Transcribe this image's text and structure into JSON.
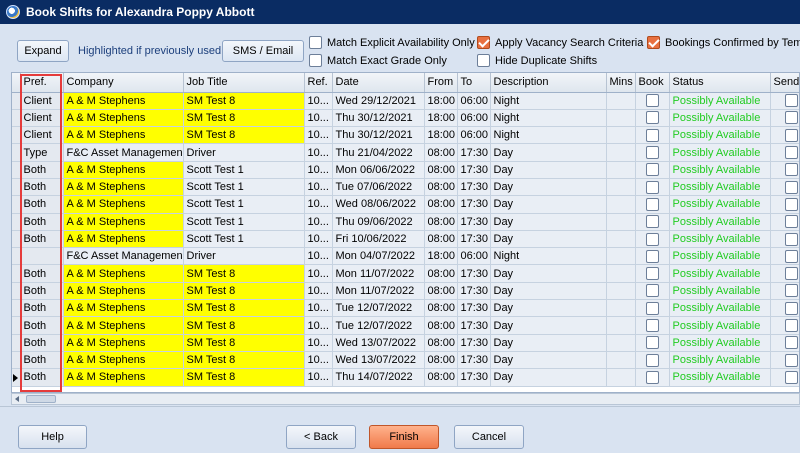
{
  "window": {
    "title": "Book Shifts for Alexandra Poppy Abbott"
  },
  "toolbar": {
    "expand_label": "Expand",
    "highlight_label": "Highlighted if previously used",
    "sms_label": "SMS / Email",
    "options": {
      "match_availability": {
        "label": "Match Explicit Availability Only",
        "checked": false
      },
      "match_grade": {
        "label": "Match Exact Grade Only",
        "checked": false
      },
      "apply_vacancy": {
        "label": "Apply Vacancy Search Criteria",
        "checked": true
      },
      "hide_duplicates": {
        "label": "Hide Duplicate Shifts",
        "checked": false
      },
      "bookings_confirmed": {
        "label": "Bookings Confirmed by Temp",
        "checked": true
      }
    }
  },
  "grid": {
    "columns": [
      "Pref.",
      "Company",
      "Job Title",
      "Ref.",
      "Date",
      "From",
      "To",
      "Description",
      "Mins",
      "Book",
      "Status",
      "Send"
    ],
    "rows": [
      {
        "pref": "Client",
        "company": "A & M Stephens",
        "job": "SM Test 8",
        "ref": "10...",
        "date": "Wed 29/12/2021",
        "from": "18:00",
        "to": "06:00",
        "desc": "Night",
        "mins": "",
        "status": "Possibly Available",
        "highlight": true
      },
      {
        "pref": "Client",
        "company": "A & M Stephens",
        "job": "SM Test 8",
        "ref": "10...",
        "date": "Thu 30/12/2021",
        "from": "18:00",
        "to": "06:00",
        "desc": "Night",
        "mins": "",
        "status": "Possibly Available",
        "highlight": true
      },
      {
        "pref": "Client",
        "company": "A & M Stephens",
        "job": "SM Test 8",
        "ref": "10...",
        "date": "Thu 30/12/2021",
        "from": "18:00",
        "to": "06:00",
        "desc": "Night",
        "mins": "",
        "status": "Possibly Available",
        "highlight": true
      },
      {
        "pref": "Type",
        "company": "F&C Asset Managemen...",
        "job": "Driver",
        "ref": "10...",
        "date": "Thu 21/04/2022",
        "from": "08:00",
        "to": "17:30",
        "desc": "Day",
        "mins": "",
        "status": "Possibly Available",
        "highlight": false
      },
      {
        "pref": "Both",
        "company": "A & M Stephens",
        "job": "Scott Test 1",
        "ref": "10...",
        "date": "Mon 06/06/2022",
        "from": "08:00",
        "to": "17:30",
        "desc": "Day",
        "mins": "",
        "status": "Possibly Available",
        "highlight": "company"
      },
      {
        "pref": "Both",
        "company": "A & M Stephens",
        "job": "Scott Test 1",
        "ref": "10...",
        "date": "Tue 07/06/2022",
        "from": "08:00",
        "to": "17:30",
        "desc": "Day",
        "mins": "",
        "status": "Possibly Available",
        "highlight": "company"
      },
      {
        "pref": "Both",
        "company": "A & M Stephens",
        "job": "Scott Test 1",
        "ref": "10...",
        "date": "Wed 08/06/2022",
        "from": "08:00",
        "to": "17:30",
        "desc": "Day",
        "mins": "",
        "status": "Possibly Available",
        "highlight": "company"
      },
      {
        "pref": "Both",
        "company": "A & M Stephens",
        "job": "Scott Test 1",
        "ref": "10...",
        "date": "Thu 09/06/2022",
        "from": "08:00",
        "to": "17:30",
        "desc": "Day",
        "mins": "",
        "status": "Possibly Available",
        "highlight": "company"
      },
      {
        "pref": "Both",
        "company": "A & M Stephens",
        "job": "Scott Test 1",
        "ref": "10...",
        "date": "Fri 10/06/2022",
        "from": "08:00",
        "to": "17:30",
        "desc": "Day",
        "mins": "",
        "status": "Possibly Available",
        "highlight": "company"
      },
      {
        "pref": "",
        "company": "F&C Asset Managemen...",
        "job": "Driver",
        "ref": "10...",
        "date": "Mon 04/07/2022",
        "from": "18:00",
        "to": "06:00",
        "desc": "Night",
        "mins": "",
        "status": "Possibly Available",
        "highlight": false
      },
      {
        "pref": "Both",
        "company": "A & M Stephens",
        "job": "SM Test 8",
        "ref": "10...",
        "date": "Mon 11/07/2022",
        "from": "08:00",
        "to": "17:30",
        "desc": "Day",
        "mins": "",
        "status": "Possibly Available",
        "highlight": true
      },
      {
        "pref": "Both",
        "company": "A & M Stephens",
        "job": "SM Test 8",
        "ref": "10...",
        "date": "Mon 11/07/2022",
        "from": "08:00",
        "to": "17:30",
        "desc": "Day",
        "mins": "",
        "status": "Possibly Available",
        "highlight": true
      },
      {
        "pref": "Both",
        "company": "A & M Stephens",
        "job": "SM Test 8",
        "ref": "10...",
        "date": "Tue 12/07/2022",
        "from": "08:00",
        "to": "17:30",
        "desc": "Day",
        "mins": "",
        "status": "Possibly Available",
        "highlight": true
      },
      {
        "pref": "Both",
        "company": "A & M Stephens",
        "job": "SM Test 8",
        "ref": "10...",
        "date": "Tue 12/07/2022",
        "from": "08:00",
        "to": "17:30",
        "desc": "Day",
        "mins": "",
        "status": "Possibly Available",
        "highlight": true
      },
      {
        "pref": "Both",
        "company": "A & M Stephens",
        "job": "SM Test 8",
        "ref": "10...",
        "date": "Wed 13/07/2022",
        "from": "08:00",
        "to": "17:30",
        "desc": "Day",
        "mins": "",
        "status": "Possibly Available",
        "highlight": true
      },
      {
        "pref": "Both",
        "company": "A & M Stephens",
        "job": "SM Test 8",
        "ref": "10...",
        "date": "Wed 13/07/2022",
        "from": "08:00",
        "to": "17:30",
        "desc": "Day",
        "mins": "",
        "status": "Possibly Available",
        "highlight": true
      },
      {
        "pref": "Both",
        "company": "A & M Stephens",
        "job": "SM Test 8",
        "ref": "10...",
        "date": "Thu 14/07/2022",
        "from": "08:00",
        "to": "17:30",
        "desc": "Day",
        "mins": "",
        "status": "Possibly Available",
        "highlight": true,
        "current": true
      }
    ]
  },
  "footer": {
    "help_label": "Help",
    "back_label": "< Back",
    "finish_label": "Finish",
    "cancel_label": "Cancel"
  },
  "colors": {
    "highlight": "#ffff00",
    "available": "#22cc22",
    "accent": "#e87040",
    "titlebar": "#0a2c63"
  }
}
